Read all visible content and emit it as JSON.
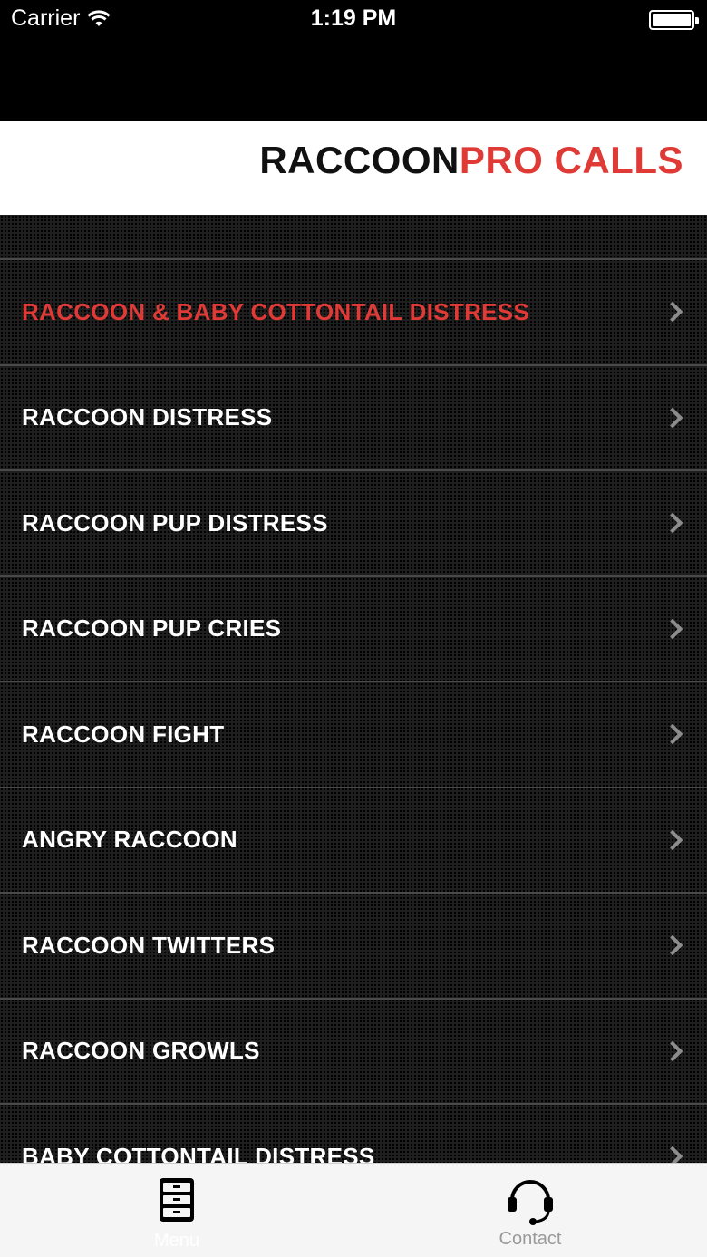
{
  "status_bar": {
    "carrier": "Carrier",
    "time": "1:19 PM"
  },
  "header": {
    "title_part1": "RACCOON",
    "title_part2": "PRO CALLS",
    "accent_color": "#e03a36"
  },
  "list": {
    "items": [
      {
        "label": "RACCOON & BABY COTTONTAIL DISTRESS",
        "active": true
      },
      {
        "label": "RACCOON DISTRESS"
      },
      {
        "label": "RACCOON PUP DISTRESS"
      },
      {
        "label": "RACCOON PUP CRIES"
      },
      {
        "label": "RACCOON FIGHT"
      },
      {
        "label": "ANGRY RACCOON"
      },
      {
        "label": "RACCOON TWITTERS"
      },
      {
        "label": "RACCOON GROWLS"
      },
      {
        "label": "BABY COTTONTAIL DISTRESS"
      }
    ]
  },
  "tab_bar": {
    "tabs": [
      {
        "label": "Menu",
        "icon": "filing-cabinet-icon",
        "selected": true
      },
      {
        "label": "Contact",
        "icon": "headset-icon"
      }
    ]
  }
}
